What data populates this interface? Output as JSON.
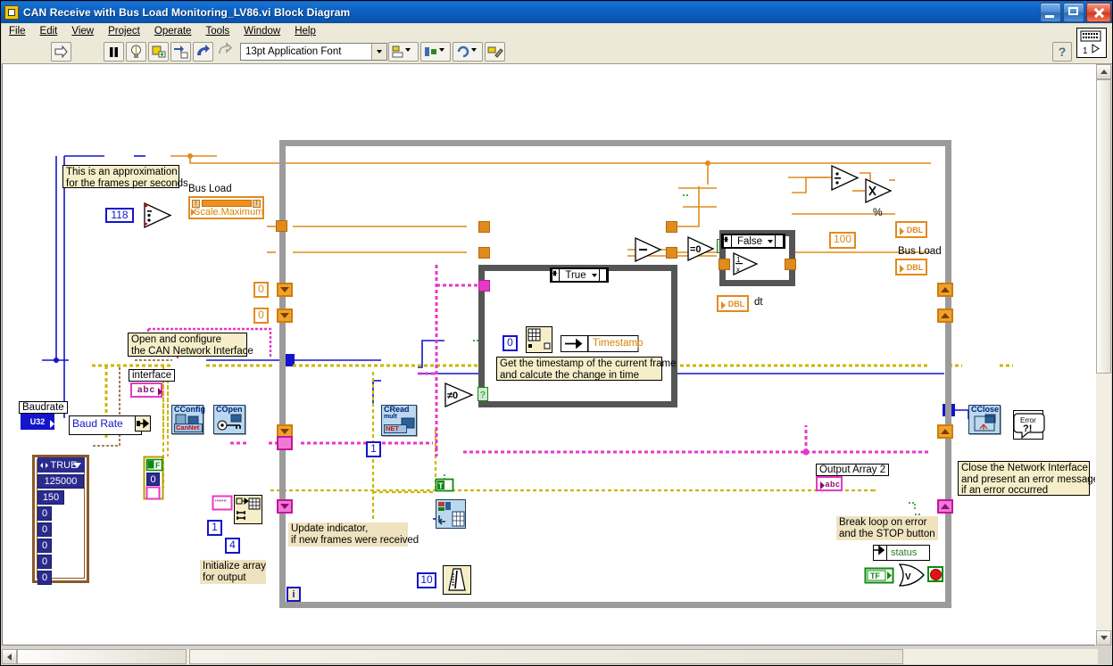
{
  "window": {
    "title": "CAN Receive with Bus Load Monitoring_LV86.vi Block Diagram",
    "app_icon": "labview-vi-icon",
    "buttons": {
      "minimize": "minimize-icon",
      "maximize": "maximize-icon",
      "close": "close-icon"
    }
  },
  "menubar": {
    "items": [
      "File",
      "Edit",
      "View",
      "Project",
      "Operate",
      "Tools",
      "Window",
      "Help"
    ]
  },
  "toolbar": {
    "run_arrow": "run-arrow-icon",
    "pause": "pause-icon",
    "highlight": "highlight-execution-bulb-icon",
    "retain_values": "retain-wire-values-icon",
    "step_into": "step-into-icon",
    "step_over": "step-over-icon",
    "step_out": "step-out-icon",
    "font": "13pt Application Font",
    "align": "align-objects-icon",
    "distribute": "distribute-objects-icon",
    "reorder": "reorder-icon",
    "cleanup": "cleanup-diagram-icon",
    "help": "?",
    "vi_icon_number": "1"
  },
  "diagram": {
    "comments": [
      {
        "id": "approx",
        "text": "This is an approximation\nfor the frames per seconds"
      },
      {
        "id": "open-config",
        "text": "Open and configure\nthe CAN Network Interface"
      },
      {
        "id": "timestamp",
        "text": "Get the timestamp of the current frame\nand calcute the change in time"
      },
      {
        "id": "init-array",
        "text": "Initialize array\nfor output"
      },
      {
        "id": "update-indicator",
        "text": "Update indicator,\nif new frames were received"
      },
      {
        "id": "break-loop",
        "text": "Break loop on error\nand the STOP button"
      },
      {
        "id": "close-iface",
        "text": "Close the Network Interface\nand present an error message,\nif an error occurred"
      }
    ],
    "labels": {
      "bus_load_gauge": "Bus Load",
      "scale_maximum": "Scale.Maximum",
      "baudrate": "Baudrate",
      "baud_rate_bundle": "Baud Rate",
      "interface": "interface",
      "timestamp_indicator": "Timestamp",
      "dt_indicator": "dt",
      "percent_indicator": "%",
      "bus_load_indicator": "Bus Load",
      "output_array_2": "Output Array 2",
      "status": "status",
      "iteration": "i"
    },
    "constants": {
      "frames_per_second": "118",
      "shift_reg_init_a": "0",
      "shift_reg_init_b": "0",
      "timestamp_index": "0",
      "read_count": "1",
      "array_rows": "1",
      "array_cols": "4",
      "wait_ms": "10",
      "percent_multiplier": "100",
      "baudrate_value": "125000",
      "cluster_value_2": "150",
      "cluster_value_3": "0",
      "cluster_value_4": "0",
      "cluster_value_5": "0",
      "cluster_value_6": "0",
      "cluster_value_7": "0",
      "enum_boolean": "TRUE",
      "zero_const_read": "0"
    },
    "case_structures": [
      {
        "id": "true-case",
        "selector": "True"
      },
      {
        "id": "false-case",
        "selector": "False"
      }
    ],
    "vi_nodes": [
      {
        "id": "cconfig",
        "title": "CConfig",
        "sub": "CanNet"
      },
      {
        "id": "copen",
        "title": "COpen",
        "sub": ""
      },
      {
        "id": "cread",
        "title": "CRead",
        "sub": "mult",
        "badge": "NET"
      },
      {
        "id": "cclose",
        "title": "CClose",
        "sub": ""
      },
      {
        "id": "error-handler",
        "title": "Error",
        "sub": "?!"
      }
    ],
    "operators": {
      "divide_fps": "divide-icon",
      "divide_load": "divide-icon",
      "multiply_percent": "multiply-icon",
      "subtract_dt": "subtract-icon",
      "reciprocal": "reciprocal-icon",
      "equal_zero": "=0-icon",
      "not_equal_zero": "!=0-icon",
      "or_gate": "or-gate-icon",
      "stop_button": "stop-button-icon"
    },
    "terminal_types": {
      "u32": "U32",
      "dbl": "DBL",
      "abc": "abc",
      "tf": "TF",
      "t_f": "T F"
    }
  }
}
